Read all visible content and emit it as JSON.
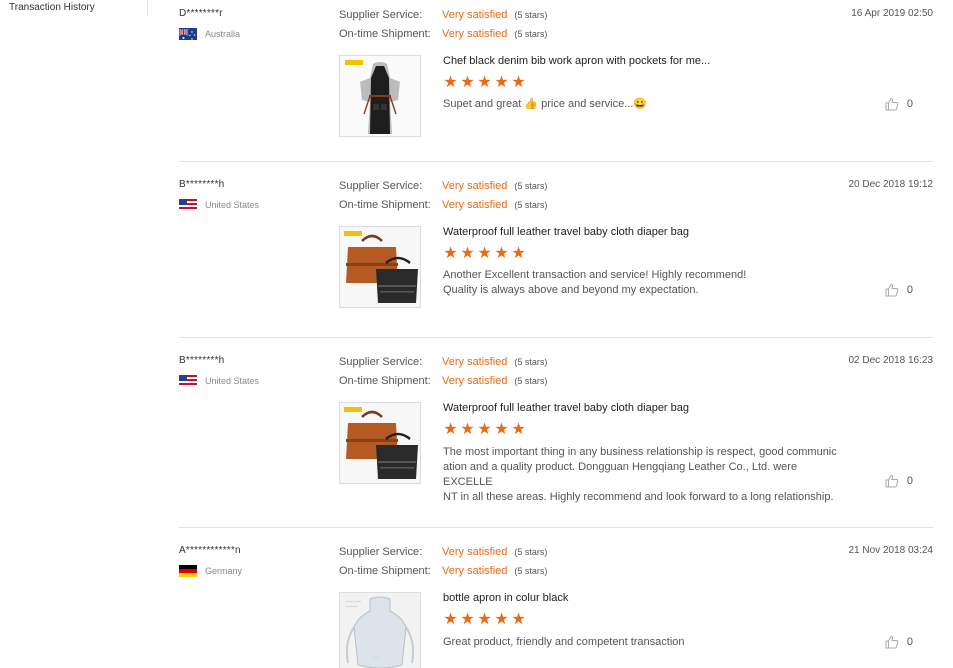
{
  "sidebar": {
    "transaction_history": "Transaction History"
  },
  "colors": {
    "accent": "#e96a14",
    "star": "#ee6a12"
  },
  "reviews": [
    {
      "buyer": "D********r",
      "country": "Australia",
      "flag": "australia-flag",
      "supplier_label": "Supplier Service:",
      "supplier_value": "Very satisfied",
      "supplier_stars": "(5 stars)",
      "shipment_label": "On-time Shipment:",
      "shipment_value": "Very satisfied",
      "shipment_stars": "(5 stars)",
      "date": "16 Apr 2019 02:50",
      "product_title": "Chef black denim bib work apron with pockets for me...",
      "rating": 5,
      "comment": "Supet and great 👍 price and service...😀",
      "likes": "0"
    },
    {
      "buyer": "B********h",
      "country": "United States",
      "flag": "us-flag",
      "supplier_label": "Supplier Service:",
      "supplier_value": "Very satisfied",
      "supplier_stars": "(5 stars)",
      "shipment_label": "On-time Shipment:",
      "shipment_value": "Very satisfied",
      "shipment_stars": "(5 stars)",
      "date": "20 Dec 2018 19:12",
      "product_title": "Waterproof full leather travel baby cloth diaper bag",
      "rating": 5,
      "comment": "Another Excellent transaction and service! Highly recommend!\nQuality is always above and beyond my expectation.",
      "likes": "0"
    },
    {
      "buyer": "B********h",
      "country": "United States",
      "flag": "us-flag",
      "supplier_label": "Supplier Service:",
      "supplier_value": "Very satisfied",
      "supplier_stars": "(5 stars)",
      "shipment_label": "On-time Shipment:",
      "shipment_value": "Very satisfied",
      "shipment_stars": "(5 stars)",
      "date": "02 Dec 2018 16:23",
      "product_title": "Waterproof full leather travel baby cloth diaper bag",
      "rating": 5,
      "comment": "The most important thing in any business relationship is respect, good communic\nation and a quality product. Dongguan Hengqiang Leather Co., Ltd. were EXCELLE\nNT in all these areas.  Highly recommend and look forward to a long relationship.",
      "likes": "0"
    },
    {
      "buyer": "A************n",
      "country": "Germany",
      "flag": "germany-flag",
      "supplier_label": "Supplier Service:",
      "supplier_value": "Very satisfied",
      "supplier_stars": "(5 stars)",
      "shipment_label": "On-time Shipment:",
      "shipment_value": "Very satisfied",
      "shipment_stars": "(5 stars)",
      "date": "21 Nov 2018 03:24",
      "product_title": "bottle apron in colur black",
      "rating": 5,
      "comment": "Great product, friendly and competent transaction",
      "likes": "0"
    }
  ]
}
